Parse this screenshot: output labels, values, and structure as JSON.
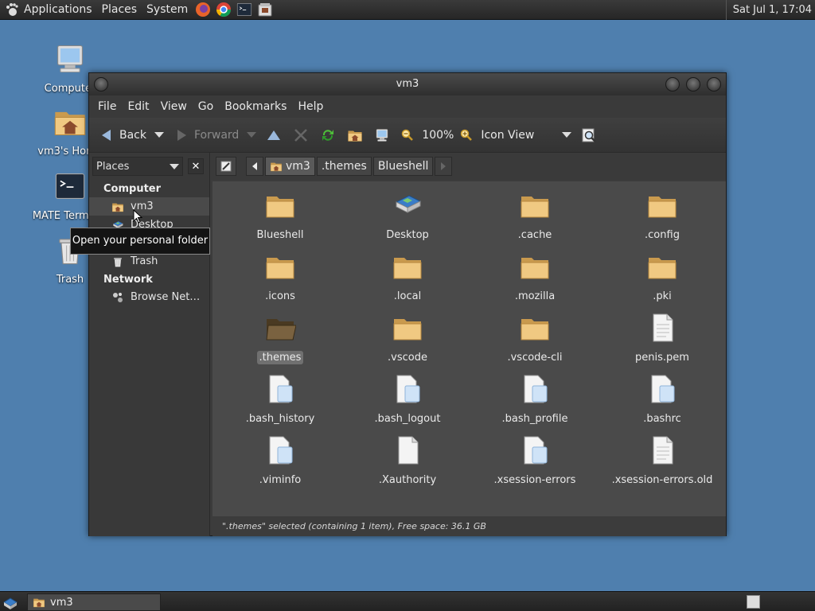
{
  "top_panel": {
    "menus": [
      "Applications",
      "Places",
      "System"
    ],
    "clock": "Sat Jul 1, 17:04",
    "launchers": [
      "firefox-icon",
      "chrome-icon",
      "terminal-icon",
      "files-icon"
    ]
  },
  "desktop_icons": [
    {
      "label": "Computer",
      "icon": "computer-icon"
    },
    {
      "label": "vm3's Home",
      "icon": "home-folder-icon"
    },
    {
      "label": "MATE Terminal",
      "icon": "terminal-icon"
    },
    {
      "label": "Trash",
      "icon": "trash-icon"
    }
  ],
  "window": {
    "title": "vm3",
    "menus": [
      "File",
      "Edit",
      "View",
      "Go",
      "Bookmarks",
      "Help"
    ],
    "toolbar": {
      "back": "Back",
      "forward": "Forward",
      "zoom": "100%",
      "view_mode": "Icon View"
    },
    "sidebar": {
      "selector": "Places",
      "close": "✕",
      "sections": {
        "computer": "Computer",
        "network": "Network"
      },
      "items": {
        "home": "vm3",
        "desktop": "Desktop",
        "trash": "Trash",
        "browse": "Browse Net…"
      }
    },
    "breadcrumbs": [
      "vm3",
      ".themes",
      "Blueshell"
    ],
    "files": [
      {
        "name": "Blueshell",
        "type": "folder"
      },
      {
        "name": "Desktop",
        "type": "desktop"
      },
      {
        "name": ".cache",
        "type": "folder"
      },
      {
        "name": ".config",
        "type": "folder"
      },
      {
        "name": ".icons",
        "type": "folder"
      },
      {
        "name": ".local",
        "type": "folder"
      },
      {
        "name": ".mozilla",
        "type": "folder"
      },
      {
        "name": ".pki",
        "type": "folder"
      },
      {
        "name": ".themes",
        "type": "folder-open",
        "selected": true
      },
      {
        "name": ".vscode",
        "type": "folder"
      },
      {
        "name": ".vscode-cli",
        "type": "folder"
      },
      {
        "name": "penis.pem",
        "type": "document"
      },
      {
        "name": ".bash_history",
        "type": "text"
      },
      {
        "name": ".bash_logout",
        "type": "text"
      },
      {
        "name": ".bash_profile",
        "type": "text"
      },
      {
        "name": ".bashrc",
        "type": "text"
      },
      {
        "name": ".viminfo",
        "type": "text"
      },
      {
        "name": ".Xauthority",
        "type": "blank"
      },
      {
        "name": ".xsession-errors",
        "type": "text"
      },
      {
        "name": ".xsession-errors.old",
        "type": "document"
      }
    ],
    "status": "\".themes\" selected (containing 1 item), Free space: 36.1 GB"
  },
  "tooltip": "Open your personal folder",
  "taskbar": {
    "task": "vm3"
  },
  "colors": {
    "desktop": "#4f7fae",
    "folder": "#e8c07a",
    "panel": "#2b2b2b",
    "view_bg": "#4a4a4a"
  }
}
